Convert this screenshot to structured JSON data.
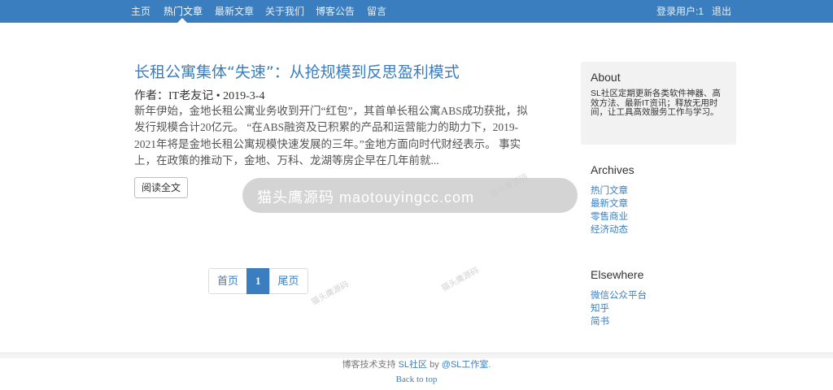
{
  "nav": {
    "items": [
      {
        "label": "主页"
      },
      {
        "label": "热门文章"
      },
      {
        "label": "最新文章"
      },
      {
        "label": "关于我们"
      },
      {
        "label": "博客公告"
      },
      {
        "label": "留言"
      }
    ],
    "user": "登录用户:1",
    "logout": "退出"
  },
  "post": {
    "title": "长租公寓集体“失速”：从抢规模到反思盈利模式",
    "meta": "作者：IT老友记 • 2019-3-4",
    "excerpt": "新年伊始，金地长租公寓业务收到开门“红包”，其首单长租公寓ABS成功获批，拟发行规模合计20亿元。 “在ABS融资及已积累的产品和运营能力的助力下，2019-2021年将是金地长租公寓规模快速发展的三年。”金地方面向时代财经表示。 事实上，在政策的推动下，金地、万科、龙湖等房企早在几年前就...",
    "read_more": "阅读全文"
  },
  "pagination": {
    "first": "首页",
    "current": "1",
    "last": "尾页"
  },
  "sidebar": {
    "about": {
      "title": "About",
      "text": "SL社区定期更新各类软件神器、高效方法、最新IT资讯；释放无用时间，让工具高效服务工作与学习。"
    },
    "archives": {
      "title": "Archives",
      "links": [
        "热门文章",
        "最新文章",
        "零售商业",
        "经济动态"
      ]
    },
    "elsewhere": {
      "title": "Elsewhere",
      "links": [
        "微信公众平台",
        "知乎",
        "简书"
      ]
    }
  },
  "footer": {
    "prefix": "博客技术支持",
    "link1": "SL社区",
    "by": "by",
    "link2": "@SL工作室",
    "suffix": ".",
    "back_to_top": "Back to top"
  },
  "watermark": {
    "text": "猫头鹰源码 maotouyingcc.com",
    "faint": "猫头鹰源码"
  }
}
